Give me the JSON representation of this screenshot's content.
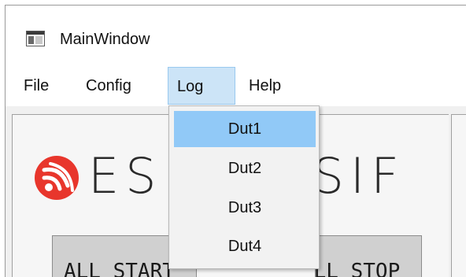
{
  "window": {
    "title": "MainWindow",
    "icon": "app-window-icon"
  },
  "menubar": {
    "items": [
      {
        "label": "File"
      },
      {
        "label": "Config"
      },
      {
        "label": "Log",
        "open": true
      },
      {
        "label": "Help"
      }
    ]
  },
  "log_menu": {
    "items": [
      {
        "label": "Dut1",
        "highlighted": true
      },
      {
        "label": "Dut2"
      },
      {
        "label": "Dut3"
      },
      {
        "label": "Dut4"
      }
    ]
  },
  "main": {
    "logo": {
      "text": "ESPRESSIF",
      "icon": "espressif-logo-icon",
      "mark_color": "#e8362c"
    },
    "buttons": {
      "all_start": "ALL START",
      "all_stop": "ALL STOP"
    }
  },
  "colors": {
    "menu_open_bg": "#cce4f7",
    "menu_item_highlight": "#91c9f7",
    "button_bg": "#d0d0d0"
  }
}
